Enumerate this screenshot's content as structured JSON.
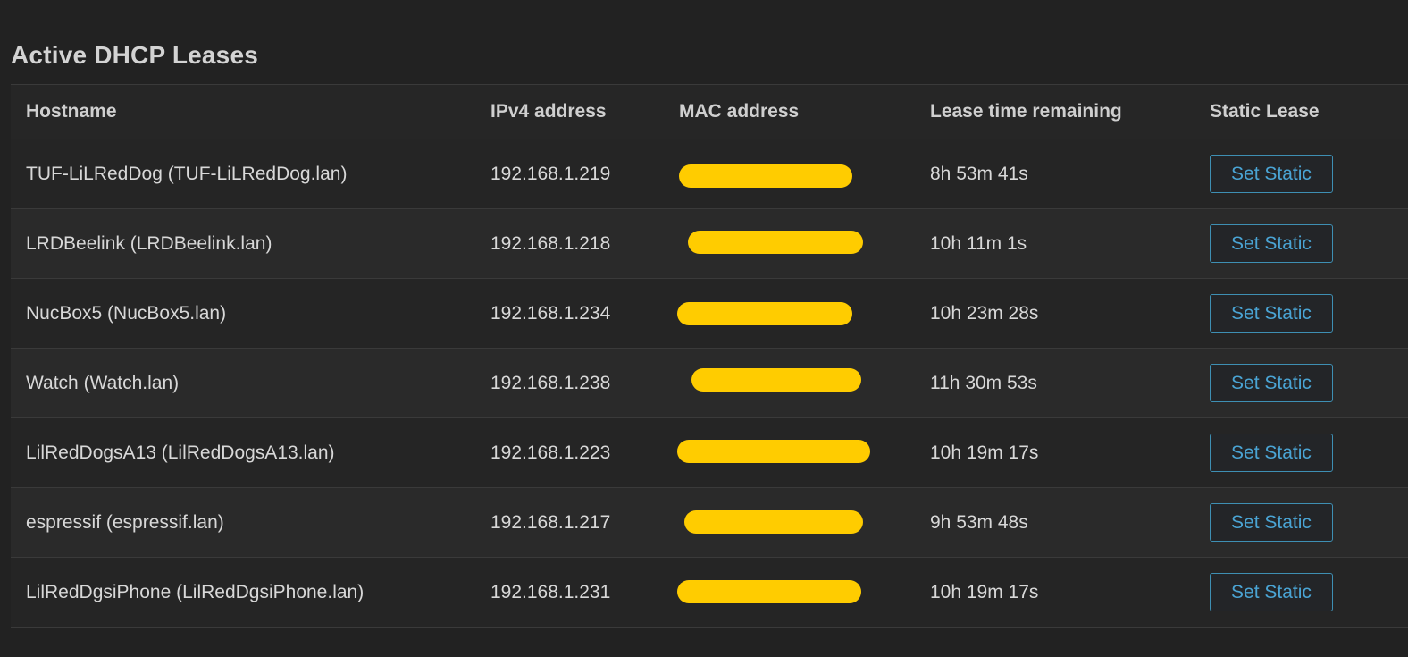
{
  "section": {
    "title": "Active DHCP Leases"
  },
  "table": {
    "headers": {
      "hostname": "Hostname",
      "ipv4": "IPv4 address",
      "mac": "MAC address",
      "lease": "Lease time remaining",
      "static": "Static Lease"
    },
    "rows": [
      {
        "hostname": "TUF-LiLRedDog (TUF-LiLRedDog.lan)",
        "ipv4": "192.168.1.219",
        "mac": "",
        "lease": "8h 53m 41s",
        "action": "Set Static"
      },
      {
        "hostname": "LRDBeelink (LRDBeelink.lan)",
        "ipv4": "192.168.1.218",
        "mac": "",
        "lease": "10h 11m 1s",
        "action": "Set Static"
      },
      {
        "hostname": "NucBox5 (NucBox5.lan)",
        "ipv4": "192.168.1.234",
        "mac": "",
        "lease": "10h 23m 28s",
        "action": "Set Static"
      },
      {
        "hostname": "Watch (Watch.lan)",
        "ipv4": "192.168.1.238",
        "mac": "",
        "lease": "11h 30m 53s",
        "action": "Set Static"
      },
      {
        "hostname": "LilRedDogsA13 (LilRedDogsA13.lan)",
        "ipv4": "192.168.1.223",
        "mac": "",
        "lease": "10h 19m 17s",
        "action": "Set Static"
      },
      {
        "hostname": "espressif (espressif.lan)",
        "ipv4": "192.168.1.217",
        "mac": "",
        "lease": "9h 53m 48s",
        "action": "Set Static"
      },
      {
        "hostname": "LilRedDgsiPhone (LilRedDgsiPhone.lan)",
        "ipv4": "192.168.1.231",
        "mac": "",
        "lease": "10h 19m 17s",
        "action": "Set Static"
      }
    ]
  },
  "colors": {
    "background": "#222222",
    "redaction": "#ffcc00",
    "button_border": "#3e8fb3",
    "button_text": "#4aa4d4"
  }
}
